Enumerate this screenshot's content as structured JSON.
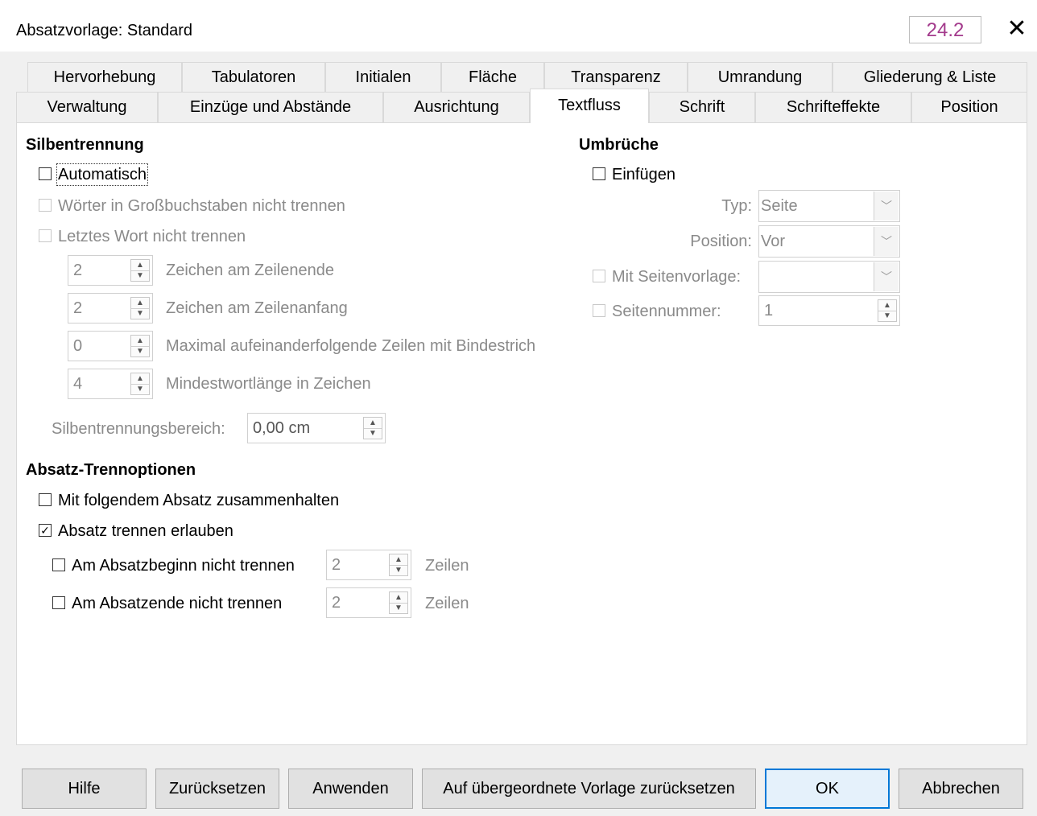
{
  "window": {
    "title": "Absatzvorlage: Standard",
    "version": "24.2",
    "close_glyph": "✕"
  },
  "tabs_row1": [
    "Hervorhebung",
    "Tabulatoren",
    "Initialen",
    "Fläche",
    "Transparenz",
    "Umrandung",
    "Gliederung & Liste"
  ],
  "tabs_row2": [
    "Verwaltung",
    "Einzüge und Abstände",
    "Ausrichtung",
    "Textfluss",
    "Schrift",
    "Schrifteffekte",
    "Position"
  ],
  "active_tab": "Textfluss",
  "hyphenation": {
    "heading": "Silbentrennung",
    "automatic": {
      "label": "Automatisch",
      "checked": false
    },
    "no_caps": {
      "label": "Wörter in Großbuchstaben nicht trennen",
      "checked": false,
      "disabled": true
    },
    "no_last_word": {
      "label": "Letztes Wort nicht trennen",
      "checked": false,
      "disabled": true
    },
    "chars_line_end": {
      "value": "2",
      "label": "Zeichen am Zeilenende"
    },
    "chars_line_begin": {
      "value": "2",
      "label": "Zeichen am Zeilenanfang"
    },
    "max_hyphens": {
      "value": "0",
      "label": "Maximal aufeinanderfolgende Zeilen mit Bindestrich"
    },
    "min_word_length": {
      "value": "4",
      "label": "Mindestwortlänge in Zeichen"
    },
    "zone": {
      "label": "Silbentrennungsbereich:",
      "value": "0,00 cm"
    }
  },
  "breaks": {
    "heading": "Umbrüche",
    "insert": {
      "label": "Einfügen",
      "checked": false
    },
    "type": {
      "label": "Typ:",
      "value": "Seite"
    },
    "position": {
      "label": "Position:",
      "value": "Vor"
    },
    "with_page_style": {
      "label": "Mit Seitenvorlage:",
      "value": "",
      "checked": false
    },
    "page_number": {
      "label": "Seitennummer:",
      "value": "1",
      "checked": false
    }
  },
  "split_options": {
    "heading": "Absatz-Trennoptionen",
    "keep_with_next": {
      "label": "Mit folgendem Absatz zusammenhalten",
      "checked": false
    },
    "allow_split": {
      "label": "Absatz trennen erlauben",
      "checked": true
    },
    "orphan": {
      "label": "Am Absatzbeginn nicht trennen",
      "value": "2",
      "unit": "Zeilen",
      "checked": false
    },
    "widow": {
      "label": "Am Absatzende nicht trennen",
      "value": "2",
      "unit": "Zeilen",
      "checked": false
    }
  },
  "buttons": {
    "help": "Hilfe",
    "reset": "Zurücksetzen",
    "apply": "Anwenden",
    "reset_parent": "Auf übergeordnete Vorlage zurücksetzen",
    "ok": "OK",
    "cancel": "Abbrechen"
  },
  "glyphs": {
    "check": "✓",
    "spin_up": "▲",
    "spin_down": "▼",
    "combo_arrow": "﹀"
  }
}
